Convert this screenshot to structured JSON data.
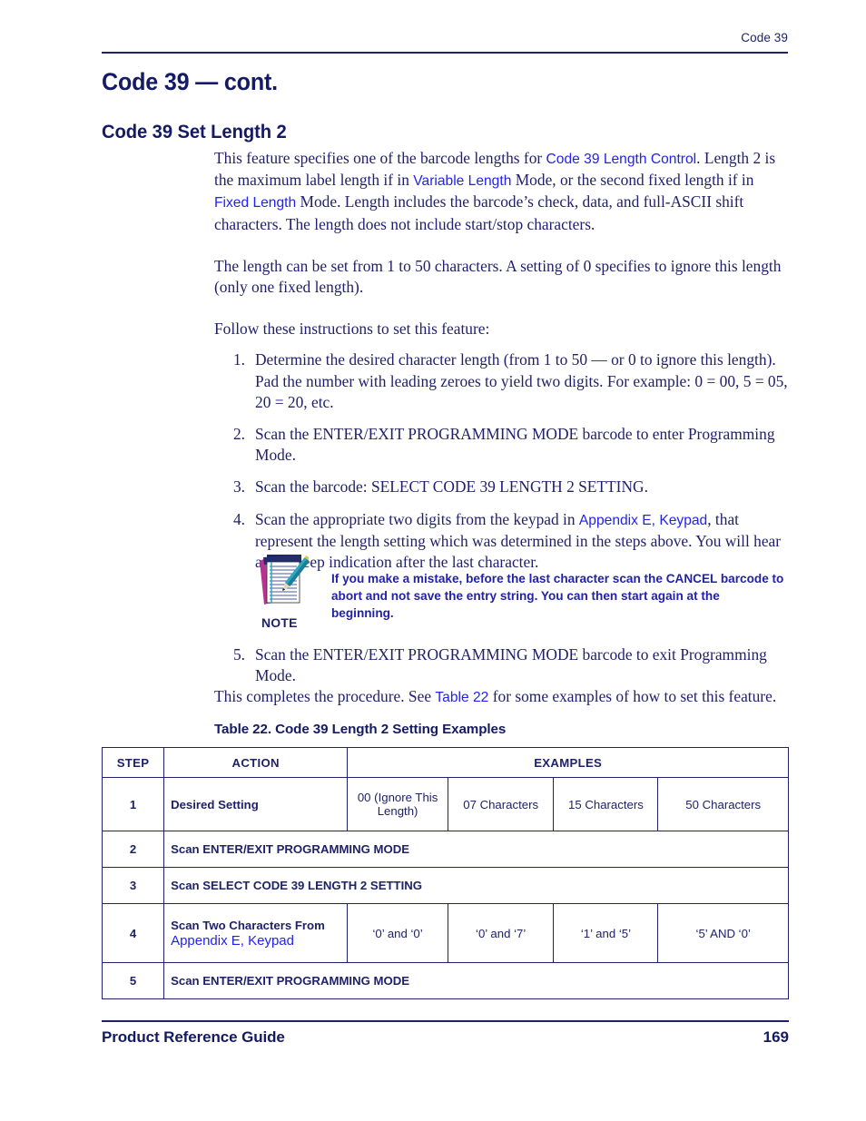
{
  "header": {
    "running_head": "Code 39"
  },
  "titles": {
    "chapter": "Code 39 — cont.",
    "section": "Code 39 Set Length 2"
  },
  "paragraphs": {
    "p1_a": "This feature specifies one of the barcode lengths for ",
    "p1_link1": "Code 39 Length Control",
    "p1_b": ". Length 2 is the maximum label length if in ",
    "p1_link2": "Variable Length",
    "p1_c": " Mode, or the second fixed length if in ",
    "p1_link3": "Fixed Length",
    "p1_d": " Mode. Length includes the barcode’s check, data, and full-ASCII shift characters.  The length does not include start/stop characters.",
    "p2": "The length can be set from 1 to 50 characters. A setting of 0 specifies to ignore this length (only one fixed length).",
    "p3": "Follow these instructions to set this feature:"
  },
  "steps": [
    {
      "num": "1.",
      "text": "Determine the desired character length (from 1 to 50 — or 0 to ignore this length). Pad the number with leading zeroes to yield two digits. For example: 0 = 00, 5 = 05, 20 = 20, etc."
    },
    {
      "num": "2.",
      "text": "Scan the ENTER/EXIT PROGRAMMING MODE barcode to enter Programming Mode."
    },
    {
      "num": "3.",
      "text": "Scan the barcode: SELECT CODE 39 LENGTH 2 SETTING."
    },
    {
      "num": "4.",
      "text_a": "Scan the appropriate two digits from the keypad in ",
      "link": "Appendix E, Keypad",
      "text_b": ", that represent the length setting which was determined in the steps above. You will hear a two-beep indication after the last character."
    }
  ],
  "note": {
    "icon": "notepad-pencil-icon",
    "label": "NOTE",
    "text": "If you make a mistake, before the last character scan the CANCEL barcode to abort and not save the entry string. You can then start again at the beginning."
  },
  "step5": {
    "num": "5.",
    "text": "Scan the ENTER/EXIT PROGRAMMING MODE barcode to exit Programming Mode."
  },
  "closing": {
    "a": "This completes the procedure. See ",
    "link": "Table 22",
    "b": " for some examples of how to set this feature."
  },
  "table": {
    "caption": "Table 22. Code 39 Length 2 Setting Examples",
    "headers": {
      "step": "STEP",
      "action": "ACTION",
      "examples": "EXAMPLES"
    },
    "rows": [
      {
        "step": "1",
        "action": "Desired Setting",
        "examples": [
          "00 (Ignore This Length)",
          "07 Characters",
          "15 Characters",
          "50 Characters"
        ]
      },
      {
        "step": "2",
        "action": "Scan ENTER/EXIT PROGRAMMING MODE",
        "examples": []
      },
      {
        "step": "3",
        "action": "Scan SELECT CODE 39 LENGTH 2 SETTING",
        "examples": []
      },
      {
        "step": "4",
        "action": "Scan Two Characters From",
        "action_link": "Appendix E, Keypad",
        "examples": [
          "‘0’ and ‘0’",
          "‘0’ and ‘7’",
          "‘1’ and ‘5’",
          "‘5’ AND ‘0’"
        ]
      },
      {
        "step": "5",
        "action": "Scan ENTER/EXIT PROGRAMMING MODE",
        "examples": []
      }
    ]
  },
  "footer": {
    "left": "Product Reference Guide",
    "page": "169"
  },
  "colors": {
    "text": "#1f1f6b",
    "heading": "#141a63",
    "link": "#2222ee",
    "note_text": "#2222a8",
    "rule": "#1f2268"
  }
}
